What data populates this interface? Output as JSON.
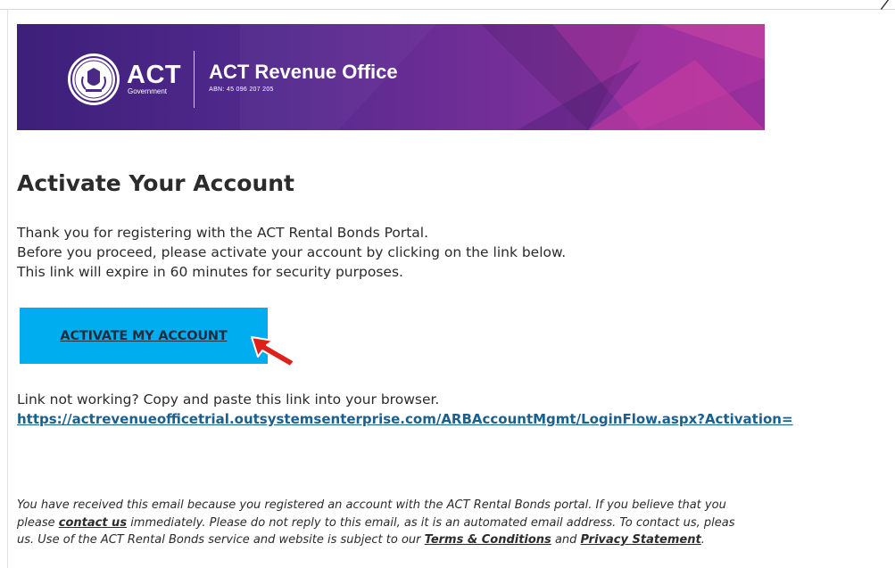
{
  "colors": {
    "banner_start": "#3d1f7a",
    "banner_end": "#9a2f9c",
    "button_bg": "#00adef",
    "link": "#1a5f8e",
    "pointer_arrow": "#e0201b"
  },
  "banner": {
    "logo_text": "ACT",
    "logo_subtext": "Government",
    "office_name": "ACT Revenue Office",
    "abn": "ABN: 45 096 207 205"
  },
  "content": {
    "title": "Activate Your Account",
    "intro_lines": [
      "Thank you for registering with the ACT Rental Bonds Portal.",
      "Before you proceed, please activate your account by clicking on the link below.",
      "This link will expire in 60 minutes for security purposes."
    ],
    "activate_button_label": "ACTIVATE MY ACCOUNT",
    "link_help_text": "Link not working? Copy and paste this link into your browser.",
    "activation_link": "https://actrevenueofficetrial.outsystemsenterprise.com/ARBAccountMgmt/LoginFlow.aspx?Activation="
  },
  "footer": {
    "line1": "You have received this email because you registered an account with the ACT Rental Bonds portal. If you believe that you",
    "line2_pre": "please ",
    "contact_link": "contact us",
    "line2_post": " immediately. Please do not reply to this email, as it is an automated email address. To contact us, pleas",
    "line3_pre": "us. Use of the ACT Rental Bonds service and website is subject to our ",
    "terms_link": "Terms & Conditions",
    "line3_mid": " and ",
    "privacy_link": "Privacy Statement",
    "line3_post": "."
  },
  "icons": {
    "crest": "act-crest-icon",
    "pointer": "red-arrow-icon"
  }
}
